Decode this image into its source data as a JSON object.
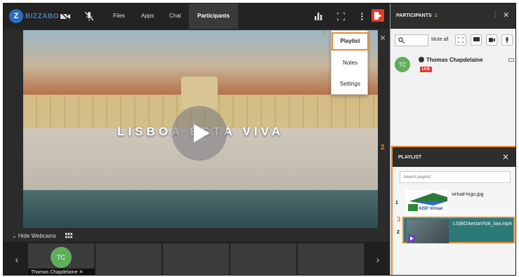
{
  "toolbar": {
    "logo_letter": "Z",
    "logo_text": "BIZZABO",
    "tabs": [
      {
        "label": "Files"
      },
      {
        "label": "Apps"
      },
      {
        "label": "Chat"
      },
      {
        "label": "Participants",
        "active": true
      }
    ]
  },
  "video": {
    "overlay_text": "LISBOA ESTÁ VIVA"
  },
  "menu": {
    "items": [
      {
        "label": "Playlist",
        "active": true
      },
      {
        "label": "Notes"
      },
      {
        "label": "Settings"
      }
    ]
  },
  "markers": {
    "one": "1",
    "two": "2",
    "three": "3"
  },
  "webcams": {
    "hide_label": "Hide Webcams",
    "user_initials": "TC",
    "user_name": "Thomas Chapdelaine"
  },
  "participants": {
    "title": "PARTICIPANTS",
    "count": "1",
    "mute_all": "Mute all",
    "user_initials": "TC",
    "user_name": "Thomas Chapdelaine",
    "live_badge": "LIVE"
  },
  "playlist": {
    "title": "PLAYLIST",
    "search_placeholder": "Search playlist",
    "items": [
      {
        "index": "1",
        "name": "virtual-logo.jpg",
        "thumb_text": "AISP Virtual"
      },
      {
        "index": "2",
        "name": "LISBOAestaVIVA_low.mp4",
        "active": true
      }
    ]
  },
  "colors": {
    "accent": "#e8892d",
    "live": "#e23a2c",
    "avatar": "#5fae5c",
    "active_item": "#2c7a78"
  }
}
